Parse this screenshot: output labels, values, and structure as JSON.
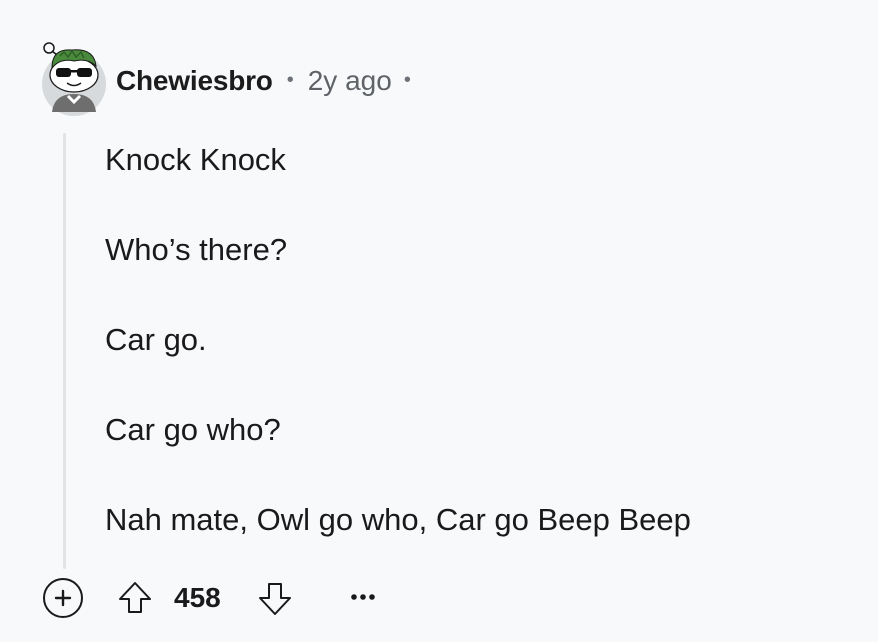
{
  "comment": {
    "author": "Chewiesbro",
    "separator": "•",
    "timestamp": "2y ago",
    "paragraphs": [
      "Knock Knock",
      "Who’s there?",
      "Car go.",
      "Car go who?",
      "Nah mate, Owl go who, Car go Beep Beep"
    ],
    "score": "458"
  },
  "icons": {
    "avatar": "snoo-avatar-with-sunglasses",
    "expand": "plus-circle-icon",
    "upvote": "arrow-up-icon",
    "downvote": "arrow-down-icon",
    "more": "ellipsis-icon"
  },
  "colors": {
    "background": "#f8f9fb",
    "text": "#1a1a1b",
    "muted": "#5f6368",
    "thread_line": "#e1e3e6",
    "avatar_bg": "#d7dadc",
    "avatar_hair": "#4a8a3c"
  }
}
